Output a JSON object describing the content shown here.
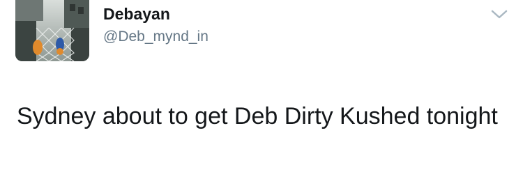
{
  "tweet": {
    "author": {
      "display_name": "Debayan",
      "handle": "@Deb_mynd_in",
      "avatar_icon": "profile-photo-icon"
    },
    "caret_icon": "chevron-down-icon",
    "text": "Sydney about to get Deb Dirty Kushed tonight"
  },
  "colors": {
    "text_primary": "#14171a",
    "text_secondary": "#657786",
    "caret": "#aab8c2",
    "background": "#ffffff"
  }
}
